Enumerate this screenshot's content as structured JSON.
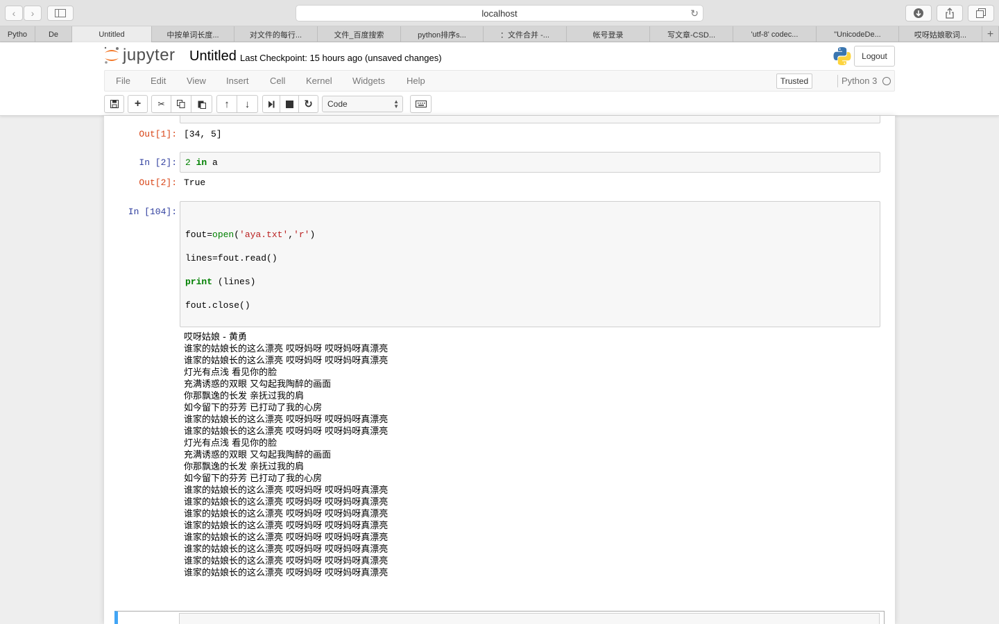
{
  "browser": {
    "url": "localhost",
    "tabs": [
      {
        "label": "Pytho",
        "active": false
      },
      {
        "label": "De",
        "active": false
      },
      {
        "label": "Untitled",
        "active": true
      },
      {
        "label": "中按单词长度...",
        "active": false
      },
      {
        "label": "对文件的每行...",
        "active": false
      },
      {
        "label": "文件_百度搜索",
        "active": false
      },
      {
        "label": "python排序s...",
        "active": false
      },
      {
        "label": "：文件合并 -...",
        "active": false
      },
      {
        "label": "帐号登录",
        "active": false
      },
      {
        "label": "写文章-CSD...",
        "active": false
      },
      {
        "label": "'utf-8' codec...",
        "active": false
      },
      {
        "label": "\"UnicodeDe...",
        "active": false
      },
      {
        "label": "哎呀姑娘歌词...",
        "active": false
      }
    ]
  },
  "header": {
    "logo_text": "jupyter",
    "notebook_name": "Untitled",
    "checkpoint": "Last Checkpoint: 15 hours ago (unsaved changes)",
    "logout_label": "Logout"
  },
  "menu": {
    "items": [
      "File",
      "Edit",
      "View",
      "Insert",
      "Cell",
      "Kernel",
      "Widgets",
      "Help"
    ],
    "trusted_label": "Trusted",
    "kernel_name": "Python 3"
  },
  "toolbar": {
    "cell_type": "Code"
  },
  "cells": {
    "out1_prompt": "Out[1]:",
    "out1_text": "[34, 5]",
    "in2_prompt": "In [2]:",
    "out2_prompt": "Out[2]:",
    "out2_text": "True",
    "in104_prompt": "In [104]:",
    "in104_code": {
      "line1": "fout=open('aya.txt','r')",
      "line2": "lines=fout.read()",
      "line3": "print (lines)",
      "line4": "fout.close()"
    },
    "lyrics": [
      "哎呀姑娘 - 黄勇",
      "谁家的姑娘长的这么漂亮 哎呀妈呀 哎呀妈呀真漂亮",
      "谁家的姑娘长的这么漂亮 哎呀妈呀 哎呀妈呀真漂亮",
      "灯光有点浅 看见你的脸",
      "充满诱惑的双眼 又勾起我陶醉的画面",
      "你那飘逸的长发 亲抚过我的肩",
      "如今留下的芬芳 已打动了我的心房",
      "谁家的姑娘长的这么漂亮 哎呀妈呀 哎呀妈呀真漂亮",
      "谁家的姑娘长的这么漂亮 哎呀妈呀 哎呀妈呀真漂亮",
      "灯光有点浅 看见你的脸",
      "充满诱惑的双眼 又勾起我陶醉的画面",
      "你那飘逸的长发 亲抚过我的肩",
      "如今留下的芬芳 已打动了我的心房",
      "谁家的姑娘长的这么漂亮 哎呀妈呀 哎呀妈呀真漂亮",
      "谁家的姑娘长的这么漂亮 哎呀妈呀 哎呀妈呀真漂亮",
      "谁家的姑娘长的这么漂亮 哎呀妈呀 哎呀妈呀真漂亮",
      "谁家的姑娘长的这么漂亮 哎呀妈呀 哎呀妈呀真漂亮",
      "谁家的姑娘长的这么漂亮 哎呀妈呀 哎呀妈呀真漂亮",
      "谁家的姑娘长的这么漂亮 哎呀妈呀 哎呀妈呀真漂亮",
      "谁家的姑娘长的这么漂亮 哎呀妈呀 哎呀妈呀真漂亮",
      "谁家的姑娘长的这么漂亮 哎呀妈呀 哎呀妈呀真漂亮"
    ]
  },
  "colors": {
    "prompt_in": "#303f9f",
    "prompt_out": "#d84315",
    "selected_cell_border": "#42a5f5"
  }
}
